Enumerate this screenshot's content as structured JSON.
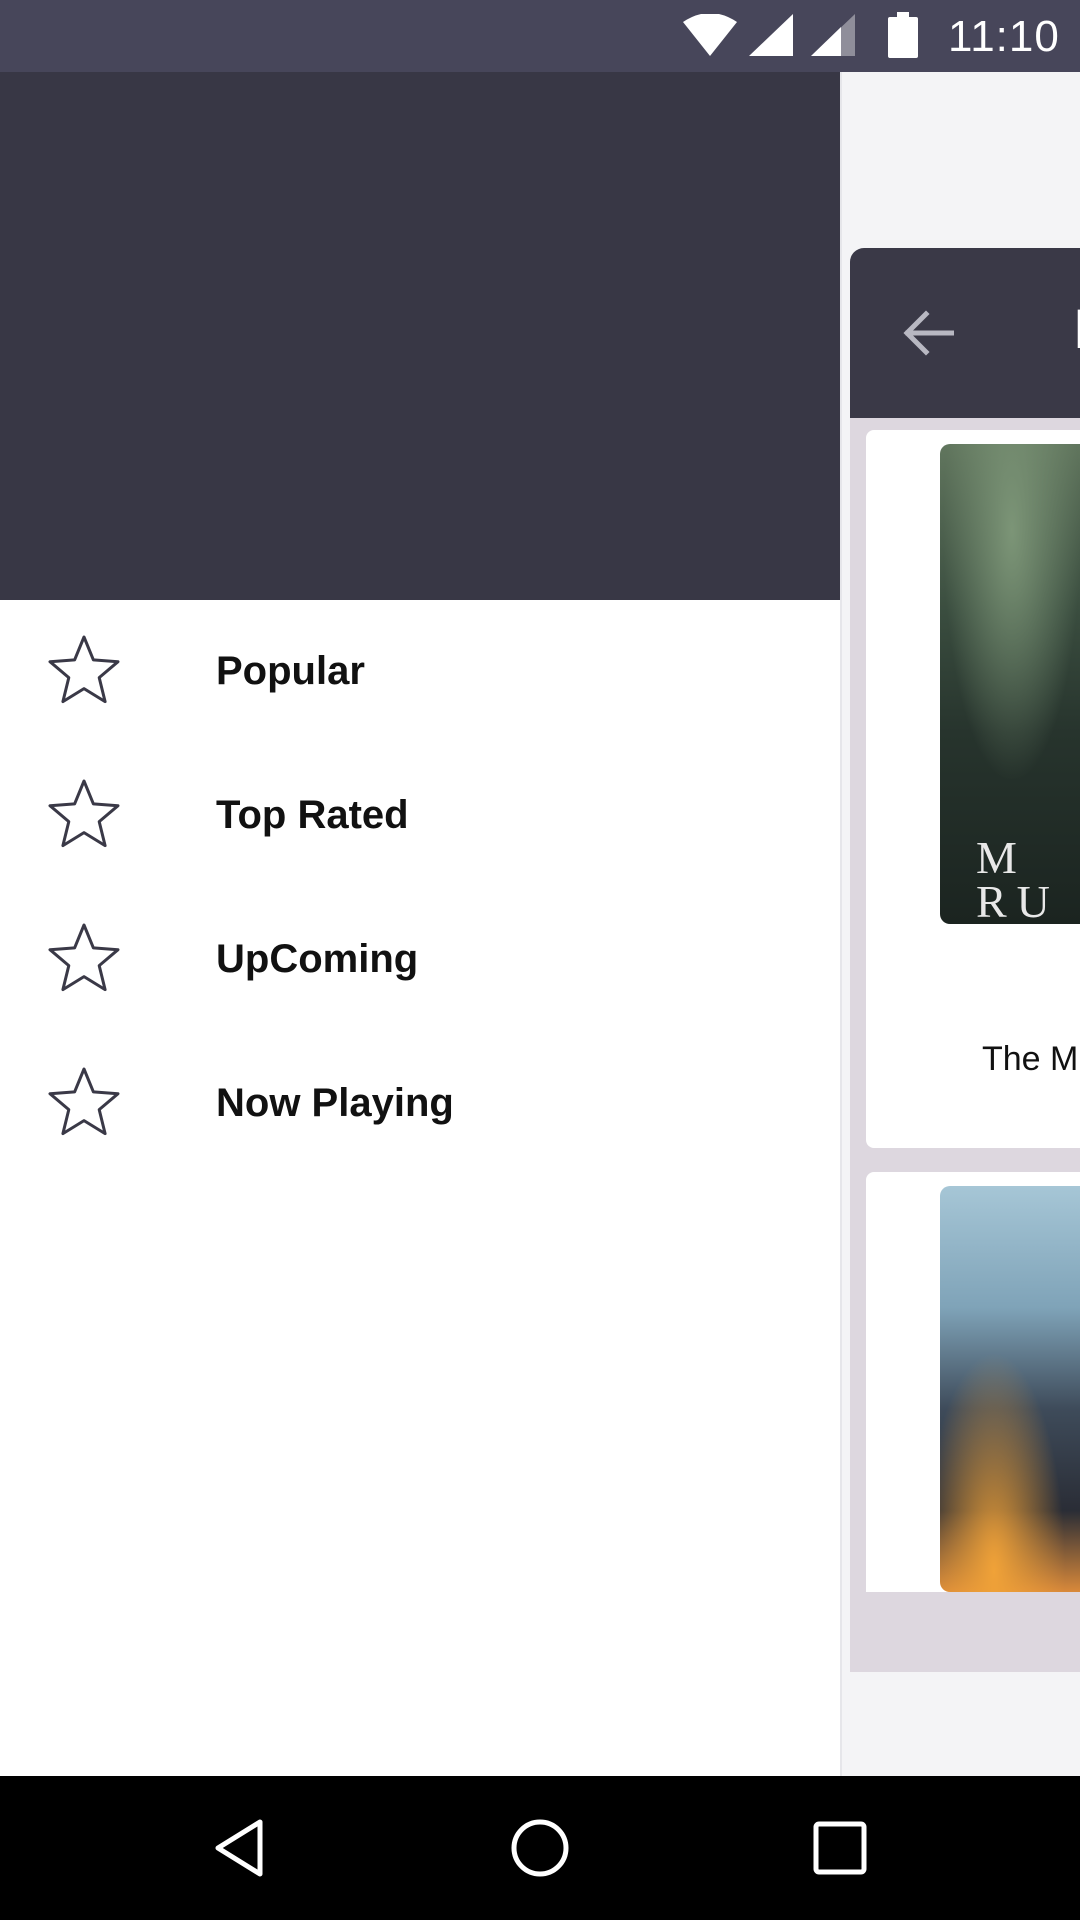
{
  "status_bar": {
    "time": "11:10",
    "icons": [
      "wifi-icon",
      "cell-signal-icon",
      "cell-signal-icon",
      "battery-icon"
    ]
  },
  "drawer": {
    "items": [
      {
        "label": "Popular",
        "icon": "star-icon"
      },
      {
        "label": "Top Rated",
        "icon": "star-icon"
      },
      {
        "label": "UpComing",
        "icon": "star-icon"
      },
      {
        "label": "Now Playing",
        "icon": "star-icon"
      }
    ]
  },
  "background_app": {
    "toolbar_title_fragment": "H",
    "cards": [
      {
        "title_fragment": "The M",
        "poster_text": "M\nRU"
      },
      {
        "title_fragment": ""
      }
    ]
  },
  "nav_bar": {
    "buttons": [
      "back-icon",
      "home-icon",
      "recents-icon"
    ]
  },
  "colors": {
    "status_bar": "#47465a",
    "drawer_header": "#383745",
    "toolbar": "#3a3947",
    "list_background": "#ddd7df"
  }
}
